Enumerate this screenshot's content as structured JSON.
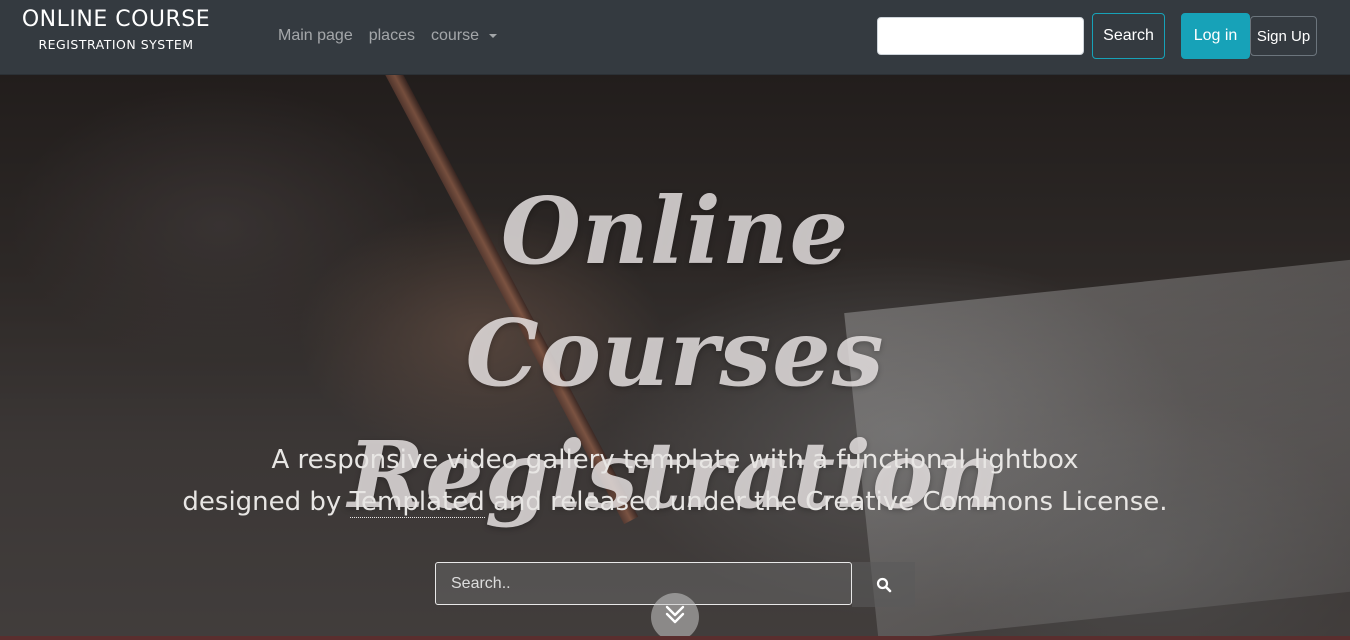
{
  "brand": {
    "line1": "ONLINE COURSE",
    "line2": "REGISTRATION SYSTEM"
  },
  "nav": {
    "items": [
      {
        "label": "Main page"
      },
      {
        "label": "places"
      },
      {
        "label": "course"
      }
    ]
  },
  "header_search": {
    "value": "",
    "button_label": "Search"
  },
  "auth": {
    "login_label": "Log in",
    "signup_label": "Sign Up"
  },
  "hero": {
    "title_line1": "Online Courses",
    "title_line2": "Registration",
    "subtitle_line1": "A responsive video gallery template with a functional lightbox",
    "subtitle_line2_pre": "designed by ",
    "subtitle_link": "Templated",
    "subtitle_line2_post": " and released under the Creative Commons License.",
    "search_placeholder": "Search..",
    "search_icon": "search-icon",
    "scroll_icon": "chevron-double-down-icon"
  },
  "colors": {
    "navbar_bg": "#343a40",
    "accent": "#17a2b8"
  }
}
